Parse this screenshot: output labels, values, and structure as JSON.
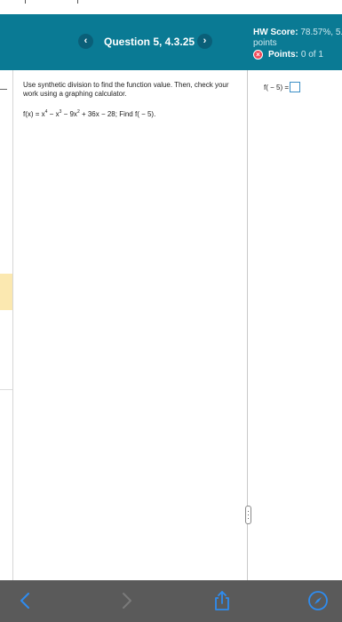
{
  "header": {
    "question_title": "Question 5, 4.3.25",
    "prev_symbol": "‹",
    "next_symbol": "›",
    "hw_score_label": "HW Score:",
    "hw_score_value": "78.57%, 5.",
    "hw_score_unit": "points",
    "points_label": "Points:",
    "points_value": "0 of 1",
    "incorrect_symbol": "×"
  },
  "question": {
    "instructions": "Use synthetic division to find the function value. Then, check your work using a graphing calculator.",
    "function_prefix": "f(x) = x",
    "exp4": "4",
    "minus_x": " − x",
    "exp3": "3",
    "minus_9x": " − 9x",
    "exp2": "2",
    "tail": " + 36x − 28; Find f( − 5)."
  },
  "answer": {
    "label": "f( − 5) =",
    "value": ""
  },
  "toolbar": {
    "back": "back-arrow-icon",
    "forward": "forward-arrow-icon",
    "share": "share-icon",
    "safari": "compass-icon"
  },
  "colors": {
    "header_bg": "#0a7a94",
    "toolbar_bg": "#5a5a5a",
    "icon_blue": "#2e8cf0",
    "incorrect_red": "#f04a5a"
  }
}
